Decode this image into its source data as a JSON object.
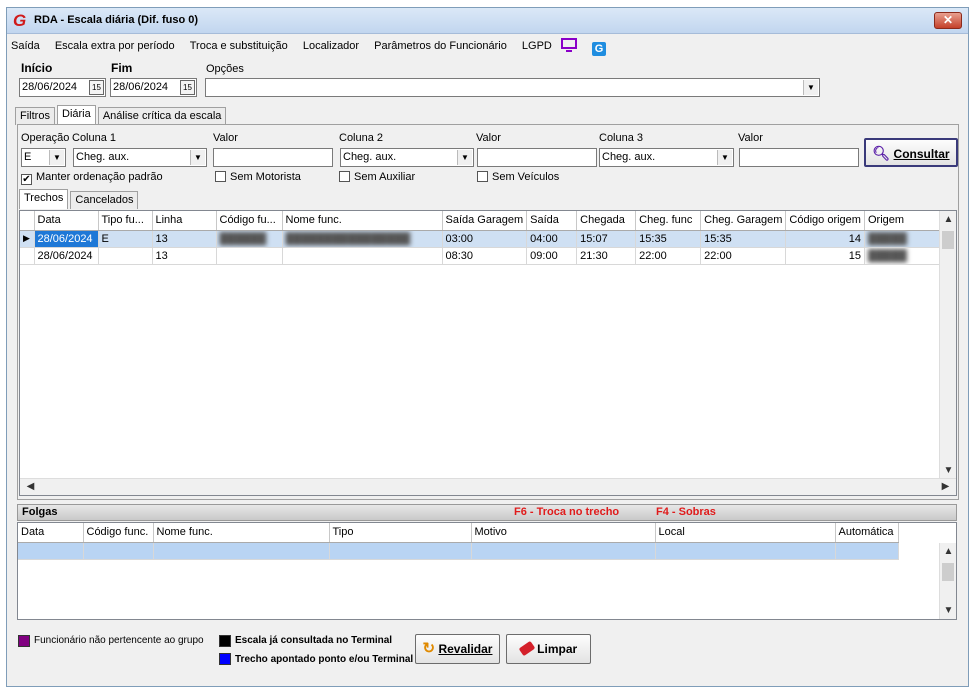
{
  "window": {
    "title": "RDA - Escala diária (Dif. fuso 0)",
    "close": "✕"
  },
  "menu": [
    "Saída",
    "Escala extra por período",
    "Troca e substituição",
    "Localizador",
    "Parâmetros do Funcionário",
    "LGPD"
  ],
  "dates": {
    "inicio_label": "Início",
    "inicio_value": "28/06/2024",
    "fim_label": "Fim",
    "fim_value": "28/06/2024",
    "cal_icon": "15",
    "opcoes_label": "Opções",
    "opcoes_value": ""
  },
  "main_tabs": [
    "Filtros",
    "Diária",
    "Análise crítica da escala"
  ],
  "filters": {
    "operacao_label": "Operação",
    "operacao_value": "E",
    "coluna1_label": "Coluna 1",
    "coluna1_value": "Cheg. aux.",
    "valor1_label": "Valor",
    "valor1_value": "",
    "coluna2_label": "Coluna 2",
    "coluna2_value": "Cheg. aux.",
    "valor2_label": "Valor",
    "valor2_value": "",
    "coluna3_label": "Coluna 3",
    "coluna3_value": "Cheg. aux.",
    "valor3_label": "Valor",
    "valor3_value": "",
    "consultar_label": "Consultar",
    "manter_label": "Manter ordenação padrão",
    "manter_checked": "✔",
    "sem_motorista_label": "Sem Motorista",
    "sem_auxiliar_label": "Sem Auxiliar",
    "sem_veiculos_label": "Sem Veículos"
  },
  "sub_tabs": [
    "Trechos",
    "Cancelados"
  ],
  "trechos": {
    "columns": [
      "Data",
      "Tipo fu...",
      "Linha",
      "Código fu...",
      "Nome func.",
      "Saída Garagem",
      "Saída",
      "Chegada",
      "Cheg. func",
      "Cheg. Garagem",
      "Código origem",
      "Origem"
    ],
    "rows": [
      {
        "data": "28/06/2024",
        "tipo": "E",
        "linha": "13",
        "codigo": "",
        "nome": "",
        "saida_garagem": "03:00",
        "saida": "04:00",
        "chegada": "15:07",
        "cheg_func": "15:35",
        "cheg_garagem": "15:35",
        "codigo_origem": "14",
        "origem": ""
      },
      {
        "data": "28/06/2024",
        "tipo": "",
        "linha": "13",
        "codigo": "",
        "nome": "",
        "saida_garagem": "08:30",
        "saida": "09:00",
        "chegada": "21:30",
        "cheg_func": "22:00",
        "cheg_garagem": "22:00",
        "codigo_origem": "15",
        "origem": ""
      }
    ]
  },
  "folgas": {
    "title": "Folgas",
    "hint_f6": "F6 - Troca no trecho",
    "hint_f4": "F4 - Sobras",
    "columns": [
      "Data",
      "Código func.",
      "Nome func.",
      "Tipo",
      "Motivo",
      "Local",
      "Automática"
    ]
  },
  "legend": {
    "nao_pertencente": "Funcionário não pertencente ao grupo",
    "ja_consultada": "Escala já consultada no Terminal",
    "apontado": "Trecho apontado ponto e/ou Terminal",
    "colors": {
      "purple": "#800080",
      "black": "#000000",
      "blue": "#0000ff"
    }
  },
  "buttons": {
    "revalidar": "Revalidar",
    "limpar": "Limpar"
  },
  "colors": {
    "accent_red": "#e01b1b",
    "selection_blue": "#1e78d7",
    "row_highlight": "#cfe0f3"
  }
}
